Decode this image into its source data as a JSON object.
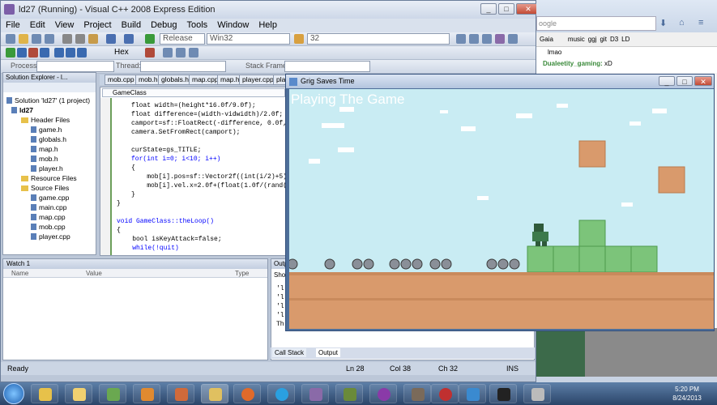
{
  "vs": {
    "title": "ld27 (Running) - Visual C++ 2008 Express Edition",
    "menu": [
      "File",
      "Edit",
      "View",
      "Project",
      "Build",
      "Debug",
      "Tools",
      "Window",
      "Help"
    ],
    "config": "Release",
    "platform": "Win32",
    "find_value": "32",
    "process_label": "Process:",
    "thread_label": "Thread:",
    "stack_label": "Stack Frame:",
    "hex_label": "Hex"
  },
  "solution_explorer": {
    "title": "Solution Explorer - l...",
    "items": [
      {
        "label": "Solution 'ld27' (1 project)",
        "kind": "solution"
      },
      {
        "label": "ld27",
        "kind": "project"
      },
      {
        "label": "Header Files",
        "kind": "folder"
      },
      {
        "label": "game.h",
        "kind": "file"
      },
      {
        "label": "globals.h",
        "kind": "file"
      },
      {
        "label": "map.h",
        "kind": "file"
      },
      {
        "label": "mob.h",
        "kind": "file"
      },
      {
        "label": "player.h",
        "kind": "file"
      },
      {
        "label": "Resource Files",
        "kind": "folder"
      },
      {
        "label": "Source Files",
        "kind": "folder"
      },
      {
        "label": "game.cpp",
        "kind": "file"
      },
      {
        "label": "main.cpp",
        "kind": "file"
      },
      {
        "label": "map.cpp",
        "kind": "file"
      },
      {
        "label": "mob.cpp",
        "kind": "file"
      },
      {
        "label": "player.cpp",
        "kind": "file"
      }
    ]
  },
  "editor": {
    "tabs": [
      "mob.cpp",
      "mob.h",
      "globals.h",
      "map.cpp",
      "map.h",
      "player.cpp",
      "pla"
    ],
    "class_combo": "GameClass",
    "lines": [
      "float width=(height*16.0f/9.0f);",
      "float difference=(width-vidwidth)/2.0f;",
      "camport=sf::FloatRect(-difference, 0.0f, v",
      "camera.SetFromRect(camport);",
      "",
      "curState=gs_TITLE;",
      "for(int i=0; i<10; i++)",
      "{",
      "    mob[i].pos=sf::Vector2f((int(i/2)+5)*3",
      "    mob[i].vel.x=2.0f+(float(1.0f/(rand()%",
      "}",
      "}",
      "",
      "void GameClass::theLoop()",
      "{",
      "    bool isKeyAttack=false;",
      "    while(!quit)"
    ]
  },
  "watch": {
    "title": "Watch 1",
    "cols": [
      "Name",
      "Value",
      "Type"
    ]
  },
  "output": {
    "title": "Outp",
    "show_label": "Sho",
    "lines": [
      "'l",
      "'l",
      "'l",
      "'l",
      "Th"
    ],
    "tabs": [
      "Call Stack",
      "Output"
    ]
  },
  "status": {
    "ready": "Ready",
    "ln": "Ln 28",
    "col": "Col 38",
    "ch": "Ch 32",
    "ins": "INS"
  },
  "game": {
    "title": "Grig Saves Time",
    "overlay": "Playing The Game"
  },
  "browser": {
    "search_hint": "oogle",
    "bookmarks": [
      "Gaia",
      "music",
      "ggj",
      "git",
      "D3",
      "LD"
    ],
    "chat": [
      {
        "text": "lmao"
      },
      {
        "user": "Dualeetity_gaming:",
        "text": "xD"
      }
    ]
  },
  "taskbar": {
    "time": "5:20 PM",
    "date": "8/24/2013"
  },
  "colors": {
    "sky": "#c9ecf3",
    "ground": "#d99a6c",
    "block": "#7cc47a",
    "titlebar": "#cdd8e8",
    "accent": "#0000ff"
  }
}
